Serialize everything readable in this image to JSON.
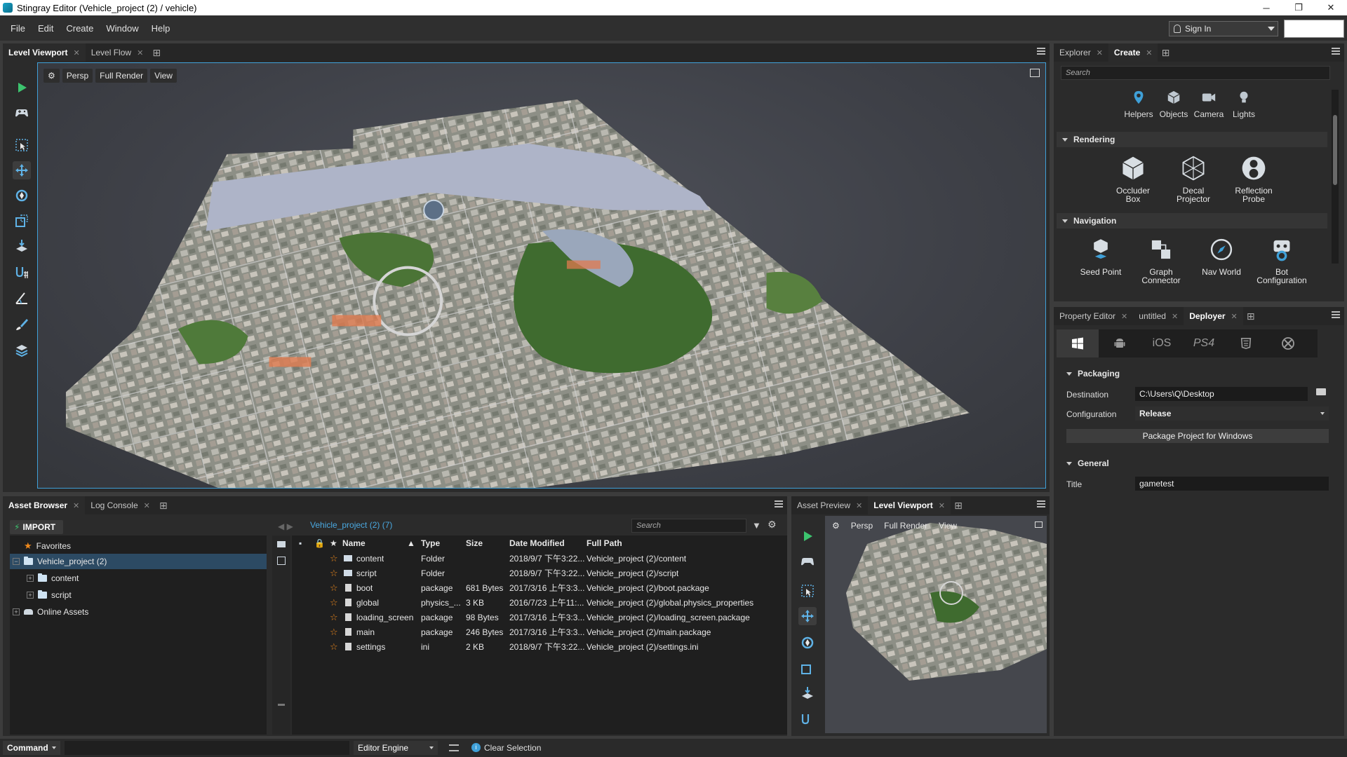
{
  "window": {
    "title": "Stingray Editor (Vehicle_project (2) / vehicle)",
    "minimize": "─",
    "restore": "❐",
    "close": "✕"
  },
  "menu": [
    "File",
    "Edit",
    "Create",
    "Window",
    "Help"
  ],
  "account": {
    "sign_in": "Sign In"
  },
  "viewport_panel": {
    "tabs": [
      {
        "label": "Level Viewport",
        "active": true
      },
      {
        "label": "Level Flow",
        "active": false
      }
    ],
    "toolbar": {
      "mode": "Persp",
      "render": "Full Render",
      "view": "View"
    }
  },
  "explorer_panel": {
    "tabs": [
      {
        "label": "Explorer",
        "active": false
      },
      {
        "label": "Create",
        "active": true
      }
    ],
    "search_placeholder": "Search",
    "categories": [
      {
        "label": "Helpers",
        "icon": "map-pin-icon"
      },
      {
        "label": "Objects",
        "icon": "cube-icon"
      },
      {
        "label": "Camera",
        "icon": "camera-icon"
      },
      {
        "label": "Lights",
        "icon": "bulb-icon"
      }
    ],
    "sections": [
      {
        "title": "Rendering",
        "items": [
          {
            "label1": "Occluder",
            "label2": "Box"
          },
          {
            "label1": "Decal",
            "label2": "Projector"
          },
          {
            "label1": "Reflection",
            "label2": "Probe"
          }
        ]
      },
      {
        "title": "Navigation",
        "items": [
          {
            "label1": "Seed Point",
            "label2": ""
          },
          {
            "label1": "Graph",
            "label2": "Connector"
          },
          {
            "label1": "Nav World",
            "label2": ""
          },
          {
            "label1": "Bot",
            "label2": "Configuration"
          }
        ]
      }
    ]
  },
  "property_panel": {
    "tabs": [
      {
        "label": "Property Editor",
        "active": false
      },
      {
        "label": "untitled",
        "active": false
      },
      {
        "label": "Deployer",
        "active": true
      }
    ],
    "platforms": [
      "windows",
      "android",
      "iOS",
      "PS4",
      "html5",
      "xbox"
    ],
    "platform_ios": "iOS",
    "platform_ps4": "PS4",
    "packaging": {
      "title": "Packaging",
      "destination_label": "Destination",
      "destination_value": "C:\\Users\\Q\\Desktop",
      "configuration_label": "Configuration",
      "configuration_value": "Release",
      "package_button": "Package Project for Windows"
    },
    "general": {
      "title": "General",
      "title_label": "Title",
      "title_value": "gametest"
    }
  },
  "asset_browser": {
    "tabs": [
      {
        "label": "Asset Browser",
        "active": true
      },
      {
        "label": "Log Console",
        "active": false
      }
    ],
    "import_label": "IMPORT",
    "path": "Vehicle_project (2) (7)",
    "search_placeholder": "Search",
    "tree": {
      "favorites": "Favorites",
      "project": "Vehicle_project (2)",
      "content": "content",
      "script": "script",
      "online": "Online Assets"
    },
    "columns": {
      "name": "Name",
      "type": "Type",
      "size": "Size",
      "modified": "Date Modified",
      "path": "Full Path"
    },
    "rows": [
      {
        "name": "content",
        "type": "Folder",
        "size": "",
        "modified": "2018/9/7 下午3:22...",
        "path": "Vehicle_project (2)/content",
        "folder": true
      },
      {
        "name": "script",
        "type": "Folder",
        "size": "",
        "modified": "2018/9/7 下午3:22...",
        "path": "Vehicle_project (2)/script",
        "folder": true
      },
      {
        "name": "boot",
        "type": "package",
        "size": "681 Bytes",
        "modified": "2017/3/16 上午3:3...",
        "path": "Vehicle_project (2)/boot.package",
        "folder": false
      },
      {
        "name": "global",
        "type": "physics_...",
        "size": "3 KB",
        "modified": "2016/7/23 上午11:...",
        "path": "Vehicle_project (2)/global.physics_properties",
        "folder": false
      },
      {
        "name": "loading_screen",
        "type": "package",
        "size": "98 Bytes",
        "modified": "2017/3/16 上午3:3...",
        "path": "Vehicle_project (2)/loading_screen.package",
        "folder": false
      },
      {
        "name": "main",
        "type": "package",
        "size": "246 Bytes",
        "modified": "2017/3/16 上午3:3...",
        "path": "Vehicle_project (2)/main.package",
        "folder": false
      },
      {
        "name": "settings",
        "type": "ini",
        "size": "2 KB",
        "modified": "2018/9/7 下午3:22...",
        "path": "Vehicle_project (2)/settings.ini",
        "folder": false
      }
    ]
  },
  "preview_panel": {
    "tabs": [
      {
        "label": "Asset Preview",
        "active": false
      },
      {
        "label": "Level Viewport",
        "active": true
      }
    ],
    "toolbar": {
      "mode": "Persp",
      "render": "Full Render",
      "view": "View"
    }
  },
  "statusbar": {
    "command": "Command",
    "engine": "Editor Engine",
    "clear_selection": "Clear Selection"
  },
  "colors": {
    "accent": "#3fa0d8",
    "star": "#f08a1c",
    "play": "#3cc36e"
  }
}
